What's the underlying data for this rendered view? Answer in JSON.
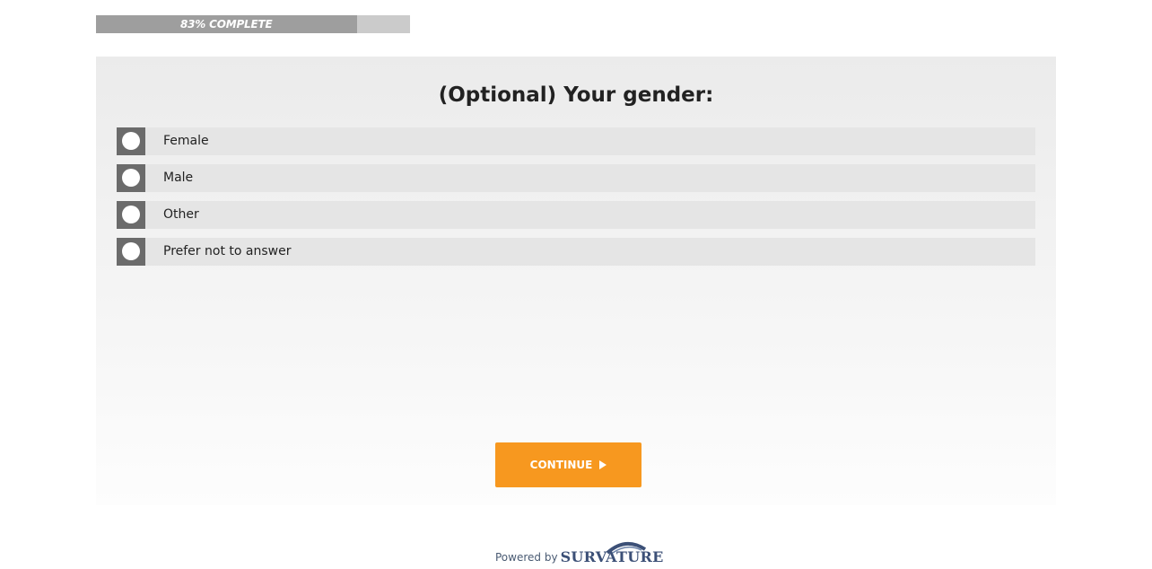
{
  "progress": {
    "label": "83% COMPLETE",
    "percent": 83
  },
  "question": {
    "title": "(Optional) Your gender:",
    "options": [
      {
        "label": "Female"
      },
      {
        "label": "Male"
      },
      {
        "label": "Other"
      },
      {
        "label": "Prefer not to answer"
      }
    ]
  },
  "actions": {
    "continue_label": "CONTINUE",
    "continue_icon": "play-icon"
  },
  "footer": {
    "powered_by": "Powered by",
    "brand": "SURVATURE"
  },
  "colors": {
    "accent": "#f7981f",
    "radio": "#6b6b6b",
    "brand": "#3c5077"
  }
}
